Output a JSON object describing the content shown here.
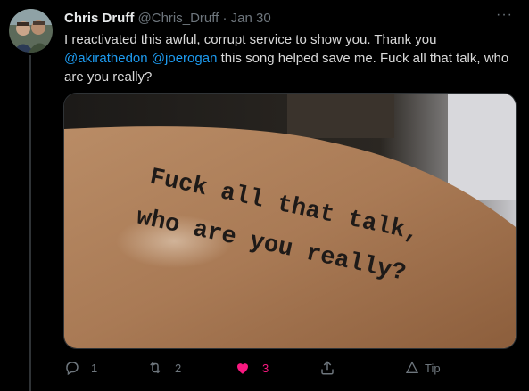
{
  "tweet": {
    "author_name": "Chris Druff",
    "author_handle": "@Chris_Druff",
    "separator": "·",
    "date": "Jan 30",
    "text_before": "I reactivated this awful, corrupt service to show you. Thank you",
    "mention_1": "@akirathedon",
    "mention_2": "@joerogan",
    "text_after": " this song helped save me. Fuck all that talk, who are you really?",
    "more_label": "···"
  },
  "media": {
    "tattoo_line_1": "Fuck all that talk,",
    "tattoo_line_2": "who are you really?"
  },
  "actions": {
    "reply_count": "1",
    "retweet_count": "2",
    "like_count": "3",
    "tip_label": "Tip"
  },
  "colors": {
    "background": "#000000",
    "mention": "#1d9bf0",
    "like": "#f91880",
    "muted": "#6e767d"
  },
  "icons": [
    "reply-icon",
    "retweet-icon",
    "heart-icon",
    "share-icon",
    "tip-icon",
    "more-icon"
  ]
}
